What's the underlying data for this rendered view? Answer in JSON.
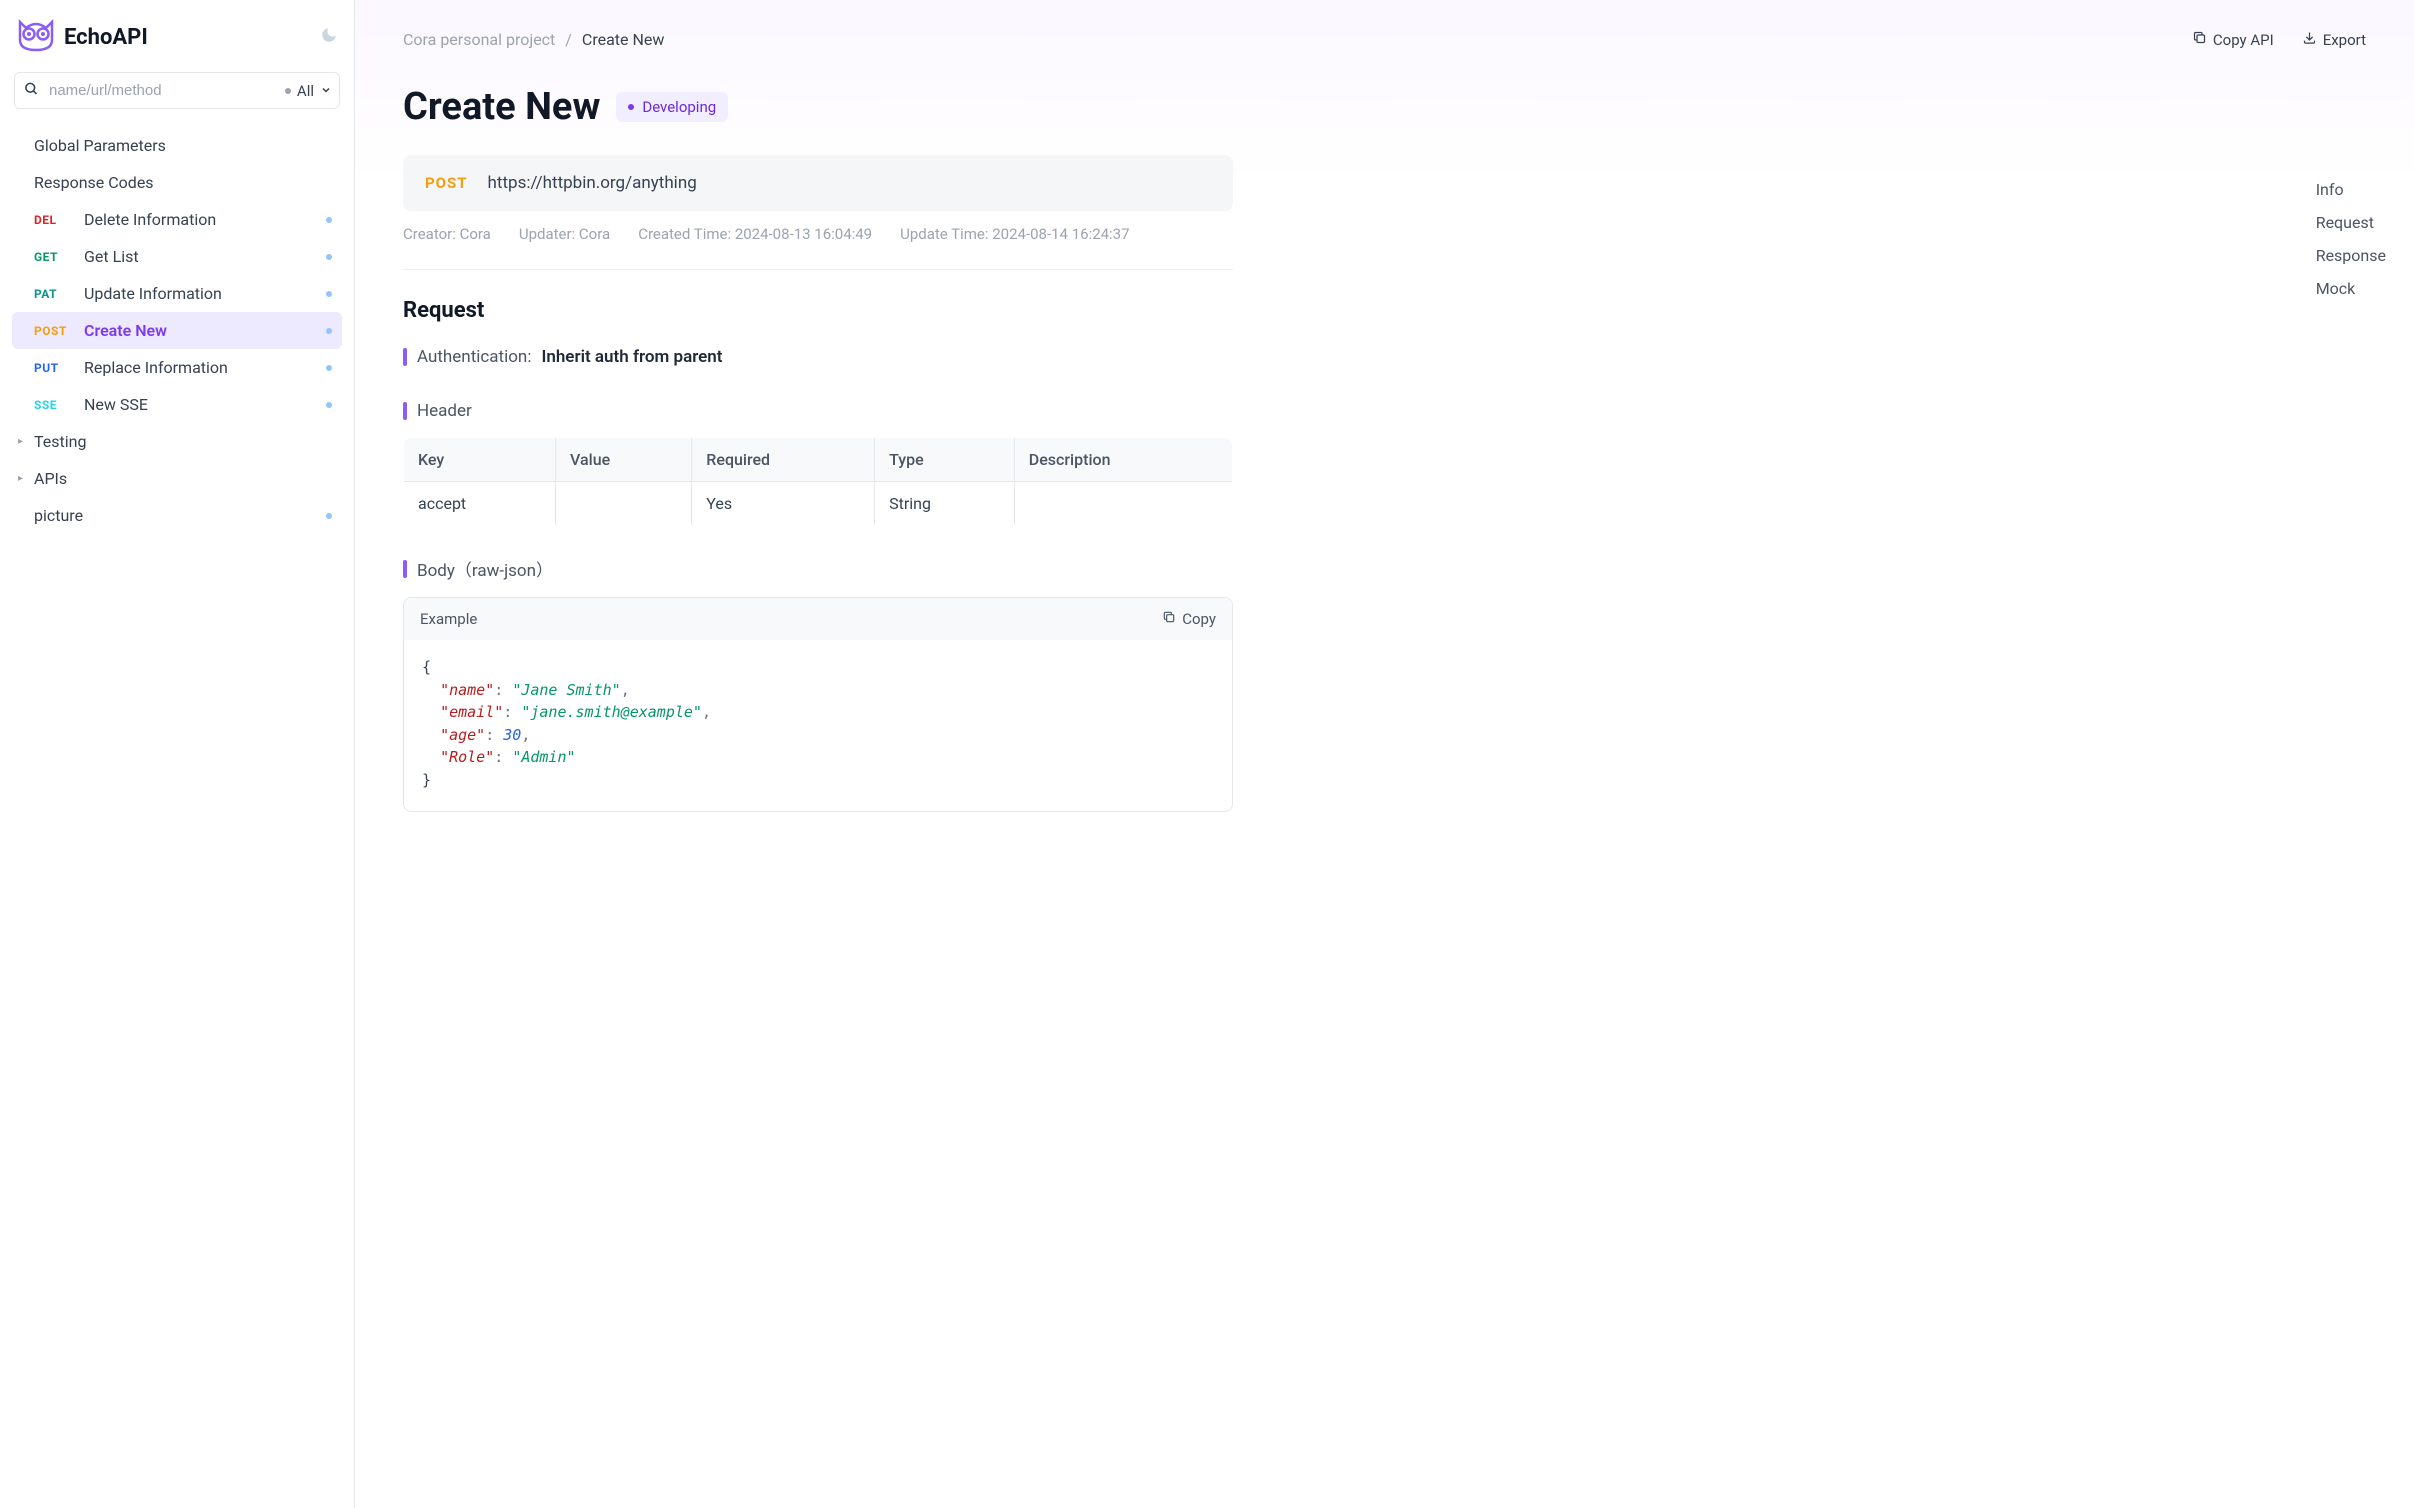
{
  "app": {
    "name": "EchoAPI"
  },
  "search": {
    "placeholder": "name/url/method",
    "filter": "All"
  },
  "sidebar": {
    "global_params": "Global Parameters",
    "response_codes": "Response Codes",
    "apis": [
      {
        "method": "DEL",
        "label": "Delete Information"
      },
      {
        "method": "GET",
        "label": "Get List"
      },
      {
        "method": "PAT",
        "label": "Update Information"
      },
      {
        "method": "POST",
        "label": "Create New",
        "selected": true
      },
      {
        "method": "PUT",
        "label": "Replace Information"
      },
      {
        "method": "SSE",
        "label": "New SSE"
      }
    ],
    "folders": [
      {
        "label": "Testing",
        "hasCaret": true
      },
      {
        "label": "APIs",
        "hasCaret": true
      },
      {
        "label": "picture",
        "hasDot": true
      }
    ]
  },
  "breadcrumb": {
    "project": "Cora personal project",
    "current": "Create New"
  },
  "actions": {
    "copy_api": "Copy API",
    "export": "Export"
  },
  "page": {
    "title": "Create New",
    "status_badge": "Developing"
  },
  "request": {
    "method": "POST",
    "url": "https://httpbin.org/anything"
  },
  "meta": {
    "creator_label": "Creator: Cora",
    "updater_label": "Updater: Cora",
    "created_label": "Created Time: 2024-08-13 16:04:49",
    "updated_label": "Update Time: 2024-08-14 16:24:37"
  },
  "sections": {
    "request_title": "Request",
    "auth_label": "Authentication:",
    "auth_value": "Inherit auth from parent",
    "header_title": "Header",
    "body_title": "Body（raw-json）",
    "example_label": "Example",
    "copy_label": "Copy"
  },
  "header_table": {
    "cols": {
      "key": "Key",
      "value": "Value",
      "required": "Required",
      "type": "Type",
      "description": "Description"
    },
    "rows": [
      {
        "key": "accept",
        "value": "",
        "required": "Yes",
        "type": "String",
        "description": ""
      }
    ]
  },
  "body_json": {
    "name": "Jane Smith",
    "email": "jane.smith@example",
    "age": 30,
    "Role": "Admin"
  },
  "anchors": {
    "info": "Info",
    "request": "Request",
    "response": "Response",
    "mock": "Mock"
  }
}
